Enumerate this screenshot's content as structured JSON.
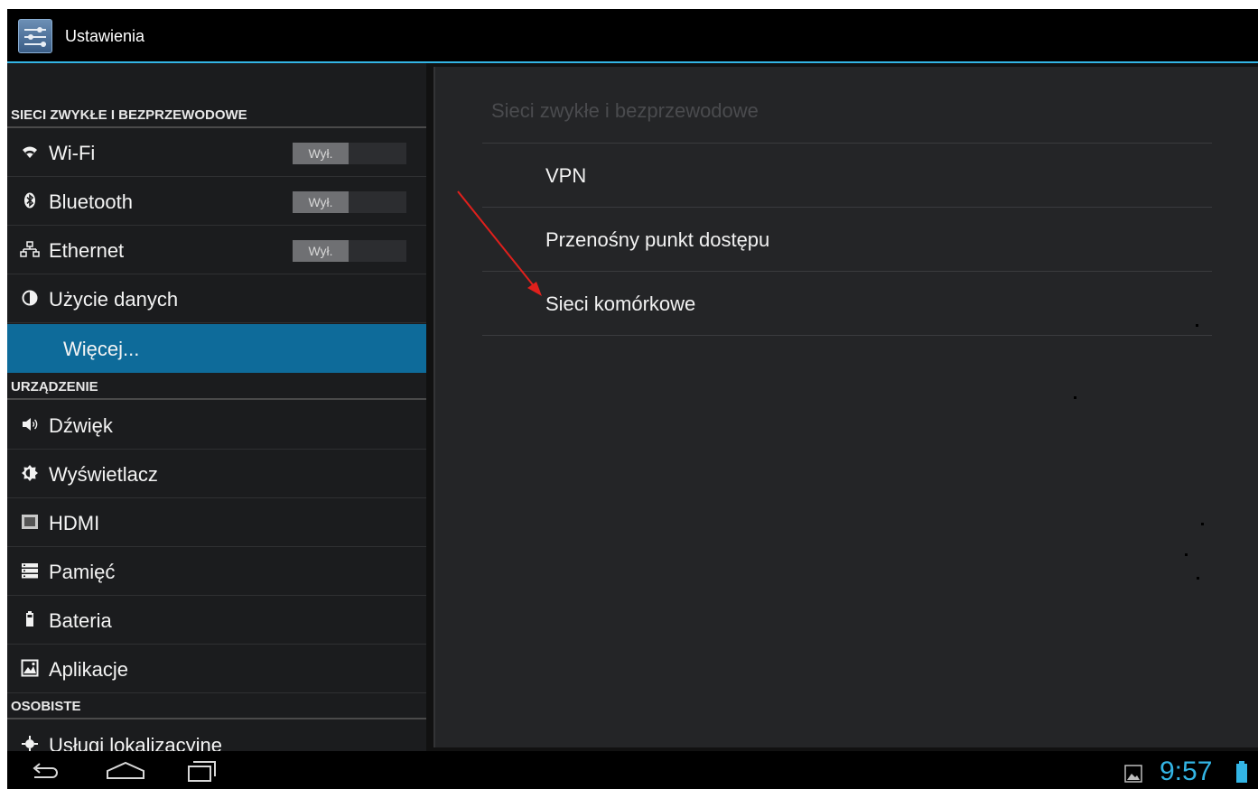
{
  "app": {
    "title": "Ustawienia",
    "icon": "settings-sliders-icon"
  },
  "left_list": {
    "section_wireless": "SIECI ZWYKŁE I BEZPRZEWODOWE",
    "section_device": "URZĄDZENIE",
    "section_personal": "OSOBISTE",
    "items": [
      {
        "label": "Wi-Fi",
        "icon": "wifi-icon",
        "toggle": "Wył."
      },
      {
        "label": "Bluetooth",
        "icon": "bluetooth-icon",
        "toggle": "Wył."
      },
      {
        "label": "Ethernet",
        "icon": "ethernet-icon",
        "toggle": "Wył."
      },
      {
        "label": "Użycie danych",
        "icon": "data-usage-icon"
      },
      {
        "label": "Więcej...",
        "selected": true
      },
      {
        "label": "Dźwięk",
        "icon": "speaker-icon"
      },
      {
        "label": "Wyświetlacz",
        "icon": "brightness-icon"
      },
      {
        "label": "HDMI",
        "icon": "hdmi-icon"
      },
      {
        "label": "Pamięć",
        "icon": "storage-icon"
      },
      {
        "label": "Bateria",
        "icon": "battery-icon"
      },
      {
        "label": "Aplikacje",
        "icon": "apps-icon"
      },
      {
        "label": "Usługi lokalizacyjne",
        "icon": "location-icon"
      }
    ]
  },
  "right_panel": {
    "title": "Sieci zwykłe i bezprzewodowe",
    "items": [
      "VPN",
      "Przenośny punkt dostępu",
      "Sieci komórkowe"
    ]
  },
  "nav_bar": {
    "clock": "9:57"
  },
  "colors": {
    "accent": "#33b5e5",
    "selected": "#0e6b9a",
    "annotation_arrow": "#e0201c"
  }
}
